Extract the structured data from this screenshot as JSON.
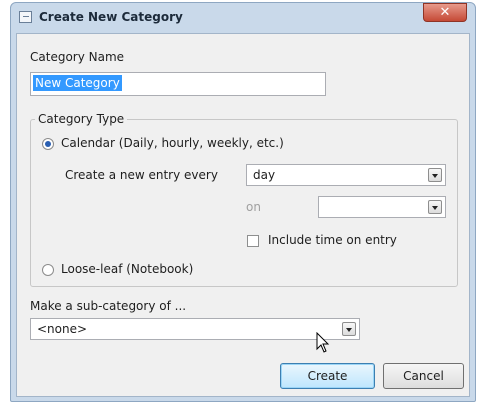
{
  "window": {
    "title": "Create New Category",
    "close_glyph": "✕"
  },
  "category_name": {
    "label": "Category Name",
    "value": "New Category"
  },
  "category_type": {
    "legend": "Category Type",
    "calendar_label": "Calendar (Daily, hourly, weekly, etc.)",
    "calendar_selected": true,
    "entry_every_label": "Create a new entry every",
    "entry_every_value": "day",
    "on_label": "on",
    "on_value": "",
    "include_time_label": "Include time on entry",
    "include_time_checked": false,
    "looseleaf_label": "Loose-leaf (Notebook)",
    "looseleaf_selected": false
  },
  "subcategory": {
    "label": "Make a sub-category of ...",
    "value": "<none>"
  },
  "buttons": {
    "create": "Create",
    "cancel": "Cancel"
  },
  "icons": {
    "window_icon": "window-icon",
    "cursor": "mouse-pointer-icon"
  }
}
